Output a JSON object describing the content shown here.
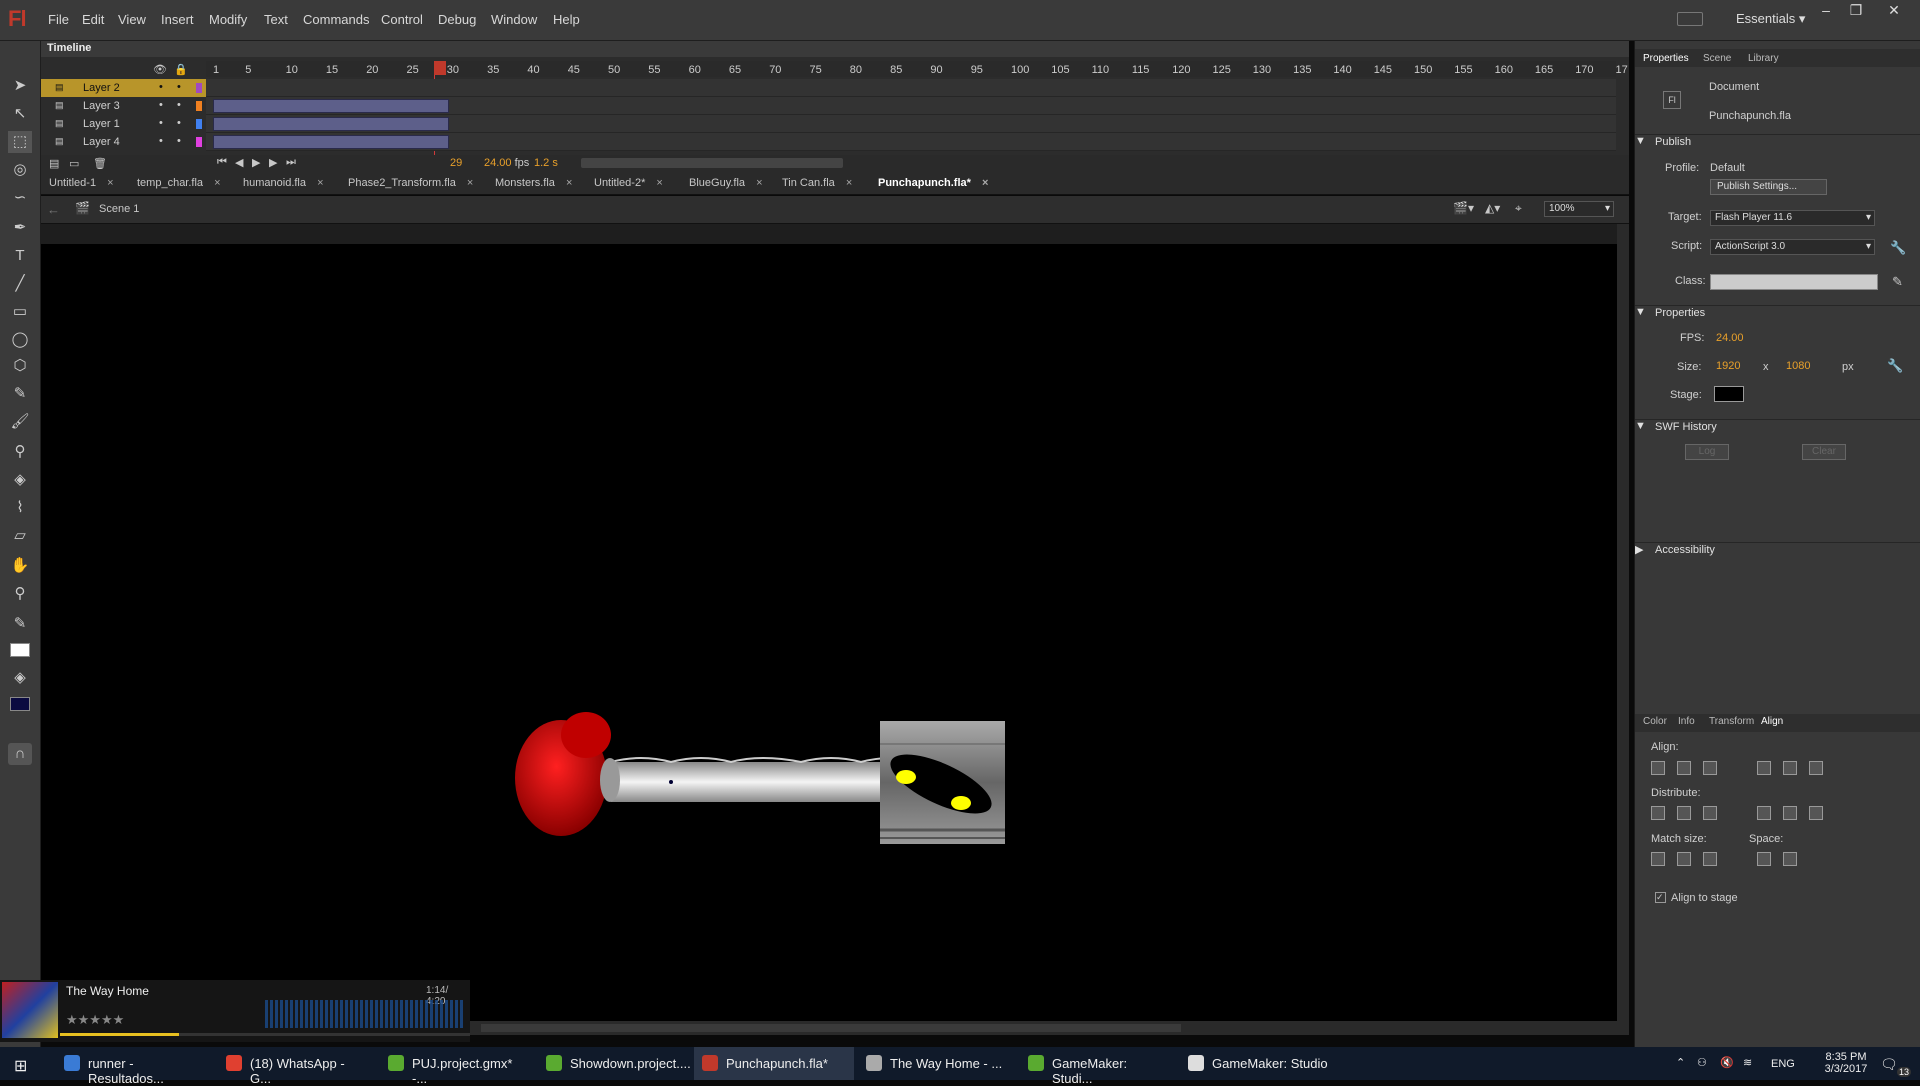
{
  "app": {
    "logo": "Fl",
    "workspace": "Essentials",
    "menu": [
      "File",
      "Edit",
      "View",
      "Insert",
      "Modify",
      "Text",
      "Commands",
      "Control",
      "Debug",
      "Window",
      "Help"
    ]
  },
  "timeline": {
    "tab": "Timeline",
    "ruler": [
      "1",
      "5",
      "10",
      "15",
      "20",
      "25",
      "30",
      "35",
      "40",
      "45",
      "50",
      "55",
      "60",
      "65",
      "70",
      "75",
      "80",
      "85",
      "90",
      "95",
      "100",
      "105",
      "110",
      "115",
      "120",
      "125",
      "130",
      "135",
      "140",
      "145",
      "150",
      "155",
      "160",
      "165",
      "170",
      "17"
    ],
    "layers": [
      {
        "name": "Layer 2",
        "color": "#a04ac0"
      },
      {
        "name": "Layer 3",
        "color": "#f08020"
      },
      {
        "name": "Layer 1",
        "color": "#4080f0"
      },
      {
        "name": "Layer 4",
        "color": "#e040e0"
      }
    ],
    "footer": {
      "frame": "29",
      "fps": "24.00",
      "fps_unit": "fps",
      "time": "1.2 s"
    }
  },
  "doc_tabs": [
    "Untitled-1",
    "temp_char.fla",
    "humanoid.fla",
    "Phase2_Transform.fla",
    "Monsters.fla",
    "Untitled-2*",
    "BlueGuy.fla",
    "Tin Can.fla",
    "Punchapunch.fla*"
  ],
  "scene": {
    "label": "Scene 1",
    "zoom": "100%"
  },
  "panel": {
    "tabs": [
      "Properties",
      "Scene",
      "Library"
    ],
    "doc_type": "Document",
    "doc_name": "Punchapunch.fla",
    "publish": {
      "title": "Publish",
      "profile_label": "Profile:",
      "profile": "Default",
      "settings_btn": "Publish Settings...",
      "target_label": "Target:",
      "target": "Flash Player 11.6",
      "script_label": "Script:",
      "script": "ActionScript 3.0",
      "class_label": "Class:"
    },
    "properties": {
      "title": "Properties",
      "fps_label": "FPS:",
      "fps": "24.00",
      "size_label": "Size:",
      "width": "1920",
      "x": "x",
      "height": "1080",
      "unit": "px",
      "stage_label": "Stage:",
      "stage_color": "#000000"
    },
    "swf": {
      "title": "SWF History",
      "log": "Log",
      "clear": "Clear"
    },
    "accessibility": "Accessibility",
    "align_tabs": [
      "Color",
      "Info",
      "Transform",
      "Align"
    ],
    "align": {
      "align": "Align:",
      "distribute": "Distribute:",
      "match": "Match size:",
      "space": "Space:",
      "to_stage": "Align to stage"
    }
  },
  "media": {
    "title": "The Way Home",
    "time": "1:14/ 4:20",
    "stars": "★★★★★"
  },
  "taskbar": {
    "items": [
      "runner - Resultados...",
      "(18) WhatsApp - G...",
      "PUJ.project.gmx* -...",
      "Showdown.project....",
      "Punchapunch.fla*",
      "The Way Home - ...",
      "GameMaker: Studi...",
      "GameMaker: Studio"
    ],
    "lang": "ENG",
    "time": "8:35 PM",
    "date": "3/3/2017",
    "notif": "13"
  }
}
